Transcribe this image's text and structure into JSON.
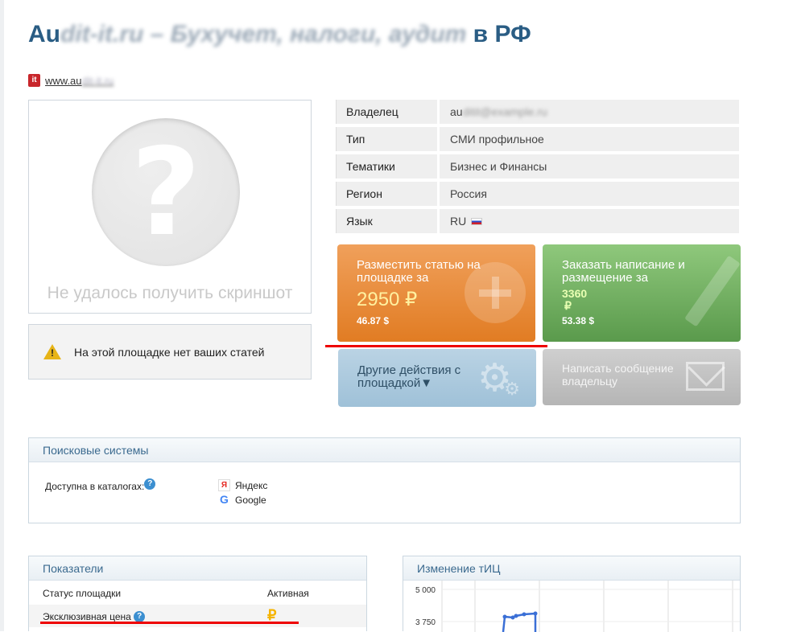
{
  "page": {
    "title_start": "Au",
    "title_blurred": "dit-it.ru – Бухучет, налоги, аудит",
    "title_end": " в РФ",
    "logo_text": "it",
    "url_start": "www.au",
    "url_blurred": "dit-it.ru"
  },
  "screenshot": {
    "question_mark": "?",
    "caption": "Не удалось получить скриншот"
  },
  "notice": {
    "text": "На этой площадке нет ваших статей",
    "icon_glyph": "!"
  },
  "info": {
    "rows": [
      {
        "key": "Владелец",
        "value_start": "au",
        "value_blurred": "ditit@example.ru"
      },
      {
        "key": "Тип",
        "value": "СМИ профильное"
      },
      {
        "key": "Тематики",
        "value": "Бизнес и Финансы"
      },
      {
        "key": "Регион",
        "value": "Россия"
      },
      {
        "key": "Язык",
        "value": "RU"
      }
    ]
  },
  "actions": {
    "place": {
      "label": "Разместить статью на площадке за",
      "price": "2950 ₽",
      "usd": "46.87 $",
      "color": "#e8862f"
    },
    "order": {
      "label": "Заказать написание и размещение за",
      "price": "3360 ₽",
      "usd": "53.38 $",
      "color": "#6aaa5a"
    },
    "other": {
      "label": "Другие действия с площадкой▼",
      "color": "#a9c9de"
    },
    "message": {
      "label": "Написать сообщение владельцу",
      "color": "#c0c0c0"
    }
  },
  "search": {
    "header": "Поисковые системы",
    "catalog_label": "Доступна в каталогах:",
    "help": "?",
    "engines": [
      {
        "icon": "yandex-icon",
        "glyph": "Я",
        "name": "Яндекс"
      },
      {
        "icon": "google-icon",
        "glyph": "G",
        "name": "Google"
      }
    ]
  },
  "indicators": {
    "header": "Показатели",
    "rows": [
      {
        "label": "Статус площадки",
        "value": "Активная"
      },
      {
        "label": "Эксклюзивная цена",
        "value": "₽"
      }
    ],
    "help": "?"
  },
  "tic": {
    "header": "Изменение тИЦ",
    "y_ticks": [
      "5 000",
      "3 750"
    ]
  },
  "chart_data": {
    "type": "line",
    "title": "Изменение тИЦ",
    "yticks": [
      "5 000",
      "3 750"
    ],
    "series": [
      {
        "values": [
          3800,
          3750,
          3800,
          3850,
          3850
        ]
      }
    ]
  },
  "colors": {
    "accent": "#2a5d84",
    "highlight_line": "#e00000"
  }
}
